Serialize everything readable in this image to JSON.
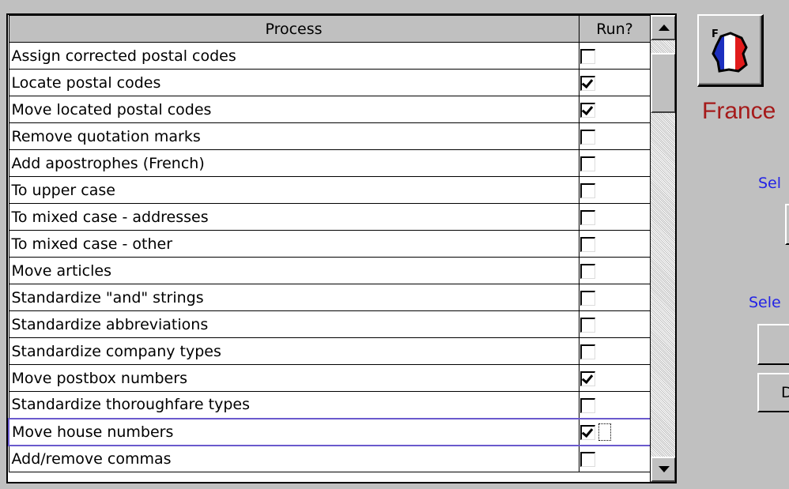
{
  "grid": {
    "headers": {
      "process": "Process",
      "run": "Run?"
    },
    "rows": [
      {
        "label": "Assign corrected postal codes",
        "checked": false
      },
      {
        "label": "Locate postal codes",
        "checked": true
      },
      {
        "label": "Move located postal codes",
        "checked": true
      },
      {
        "label": "Remove quotation marks",
        "checked": false
      },
      {
        "label": "Add apostrophes (French)",
        "checked": false
      },
      {
        "label": "To upper case",
        "checked": false
      },
      {
        "label": "To mixed case - addresses",
        "checked": false
      },
      {
        "label": "To mixed case - other",
        "checked": false
      },
      {
        "label": "Move articles",
        "checked": false
      },
      {
        "label": "Standardize \"and\" strings",
        "checked": false
      },
      {
        "label": "Standardize abbreviations",
        "checked": false
      },
      {
        "label": "Standardize company types",
        "checked": false
      },
      {
        "label": "Move postbox numbers",
        "checked": true
      },
      {
        "label": "Standardize thoroughfare types",
        "checked": false
      },
      {
        "label": "Move house numbers",
        "checked": true,
        "selected": true
      },
      {
        "label": "Add/remove commas",
        "checked": false
      }
    ]
  },
  "right_panel": {
    "flag_letter": "F",
    "country": "France",
    "select_label_1": "Sel",
    "select_label_2": "Sele",
    "button_3_label": "D"
  },
  "colors": {
    "background": "#c0c0c0",
    "country_text": "#a51a1a",
    "select_label": "#2323e6",
    "selection_border": "#6a5acd"
  }
}
